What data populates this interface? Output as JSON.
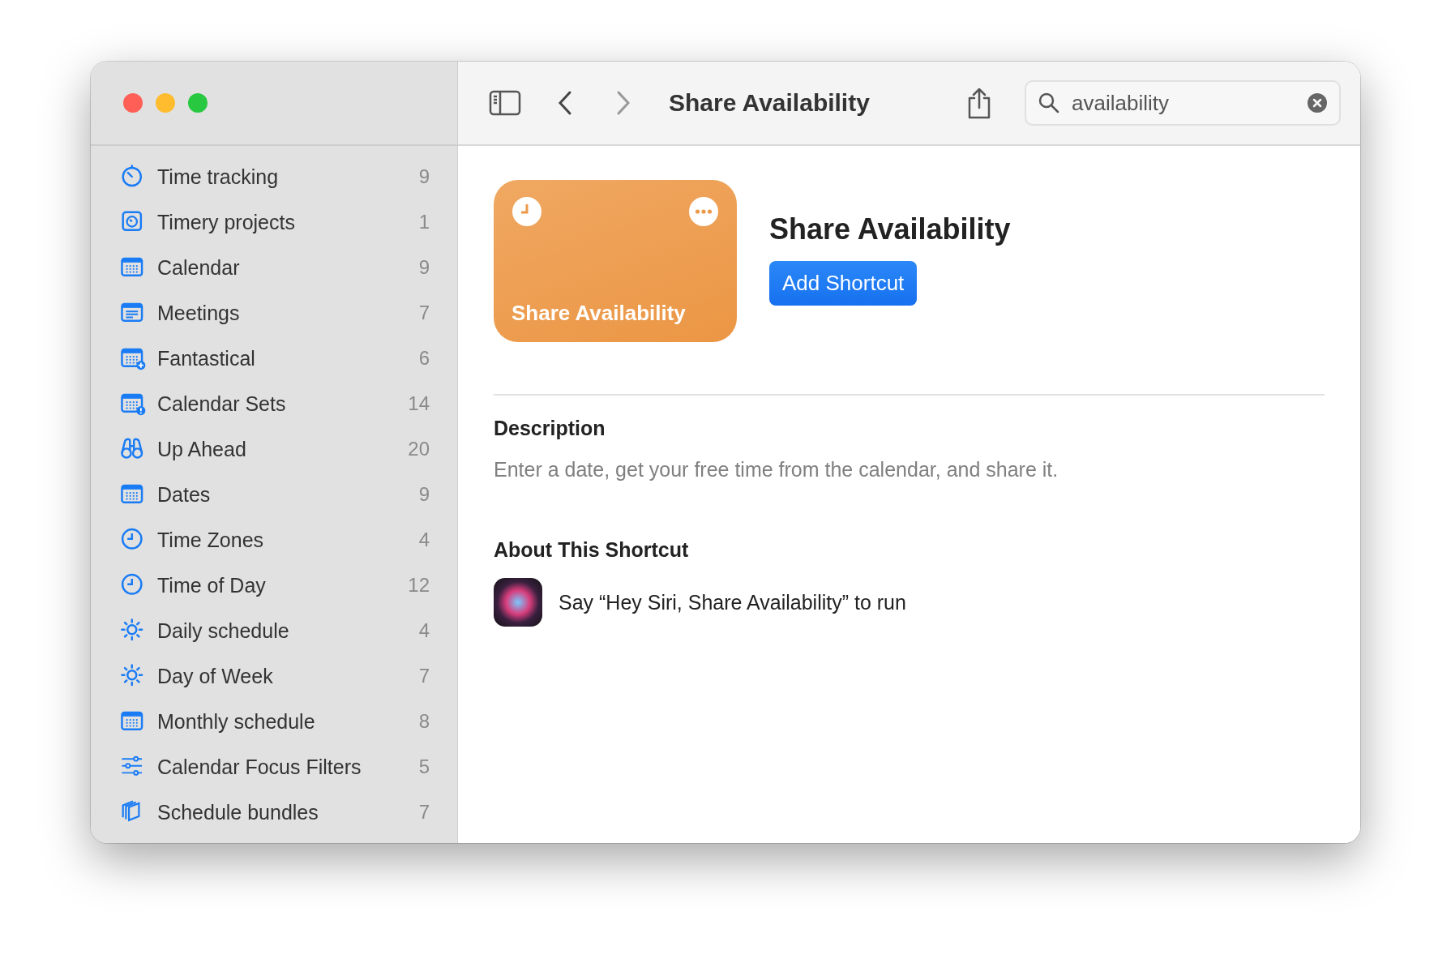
{
  "sidebar": {
    "items": [
      {
        "kind": "timer",
        "label": "Time tracking",
        "count": "9"
      },
      {
        "kind": "timersquare",
        "label": "Timery projects",
        "count": "1"
      },
      {
        "kind": "calendar",
        "label": "Calendar",
        "count": "9"
      },
      {
        "kind": "list",
        "label": "Meetings",
        "count": "7"
      },
      {
        "kind": "calplus",
        "label": "Fantastical",
        "count": "6"
      },
      {
        "kind": "calalert",
        "label": "Calendar Sets",
        "count": "14"
      },
      {
        "kind": "binoculars",
        "label": "Up Ahead",
        "count": "20"
      },
      {
        "kind": "calendar",
        "label": "Dates",
        "count": "9"
      },
      {
        "kind": "clock",
        "label": "Time Zones",
        "count": "4"
      },
      {
        "kind": "clock",
        "label": "Time of Day",
        "count": "12"
      },
      {
        "kind": "sun",
        "label": "Daily schedule",
        "count": "4"
      },
      {
        "kind": "sun",
        "label": "Day of Week",
        "count": "7"
      },
      {
        "kind": "calendar",
        "label": "Monthly schedule",
        "count": "8"
      },
      {
        "kind": "sliders",
        "label": "Calendar Focus Filters",
        "count": "5"
      },
      {
        "kind": "stack",
        "label": "Schedule bundles",
        "count": "7"
      }
    ]
  },
  "toolbar": {
    "title": "Share Availability",
    "search": {
      "value": "availability"
    }
  },
  "shortcut": {
    "card_title": "Share Availability",
    "title": "Share Availability",
    "button": "Add Shortcut"
  },
  "description": {
    "heading": "Description",
    "text": "Enter a date, get your free time from the calendar, and share it."
  },
  "about": {
    "heading": "About This Shortcut",
    "siri_text": "Say “Hey Siri, Share Availability” to run"
  }
}
